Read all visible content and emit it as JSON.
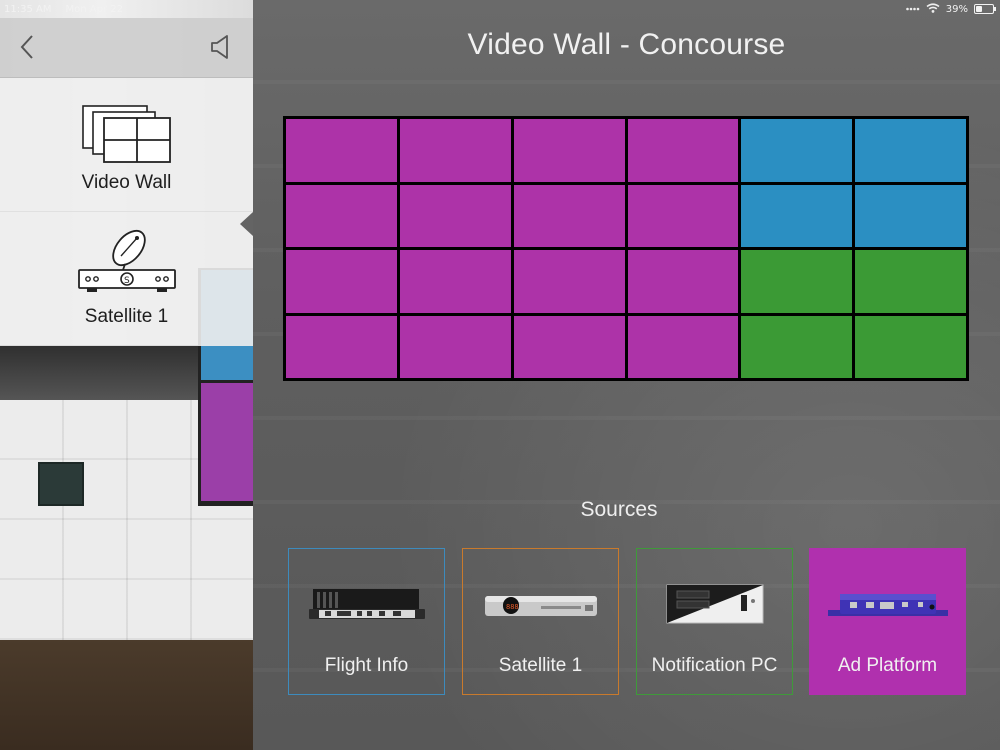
{
  "status_bar": {
    "time": "11:35 AM",
    "date": "Mon Apr 22",
    "battery_percent": "39%",
    "battery_level": 0.39
  },
  "header": {
    "back_icon": "chevron-left-icon",
    "volume_icon": "speaker-icon"
  },
  "sidebar": {
    "items": [
      {
        "label": "Video Wall",
        "icon": "video-wall-icon",
        "selected": false
      },
      {
        "label": "Satellite 1",
        "icon": "satellite-receiver-icon",
        "selected": true
      }
    ]
  },
  "main": {
    "title": "Video Wall - Concourse",
    "wall": {
      "columns": 6,
      "rows": 4,
      "tiles": [
        "purple",
        "purple",
        "purple",
        "purple",
        "blue",
        "blue",
        "purple",
        "purple",
        "purple",
        "purple",
        "blue",
        "blue",
        "purple",
        "purple",
        "purple",
        "purple",
        "green",
        "green",
        "purple",
        "purple",
        "purple",
        "purple",
        "green",
        "green"
      ],
      "colors": {
        "purple": "#ad33a8",
        "blue": "#2b8fc2",
        "green": "#3b9a35"
      }
    },
    "sources_heading": "Sources",
    "sources": [
      {
        "label": "Flight Info",
        "icon": "media-player-icon",
        "accent": "#3d8bbd",
        "active": false
      },
      {
        "label": "Satellite 1",
        "icon": "satellite-receiver-icon",
        "accent": "#c97a2c",
        "active": false
      },
      {
        "label": "Notification PC",
        "icon": "desktop-pc-icon",
        "accent": "#3f9a3a",
        "active": false
      },
      {
        "label": "Ad Platform",
        "icon": "signage-player-icon",
        "accent": "#b030ae",
        "active": true
      }
    ]
  }
}
